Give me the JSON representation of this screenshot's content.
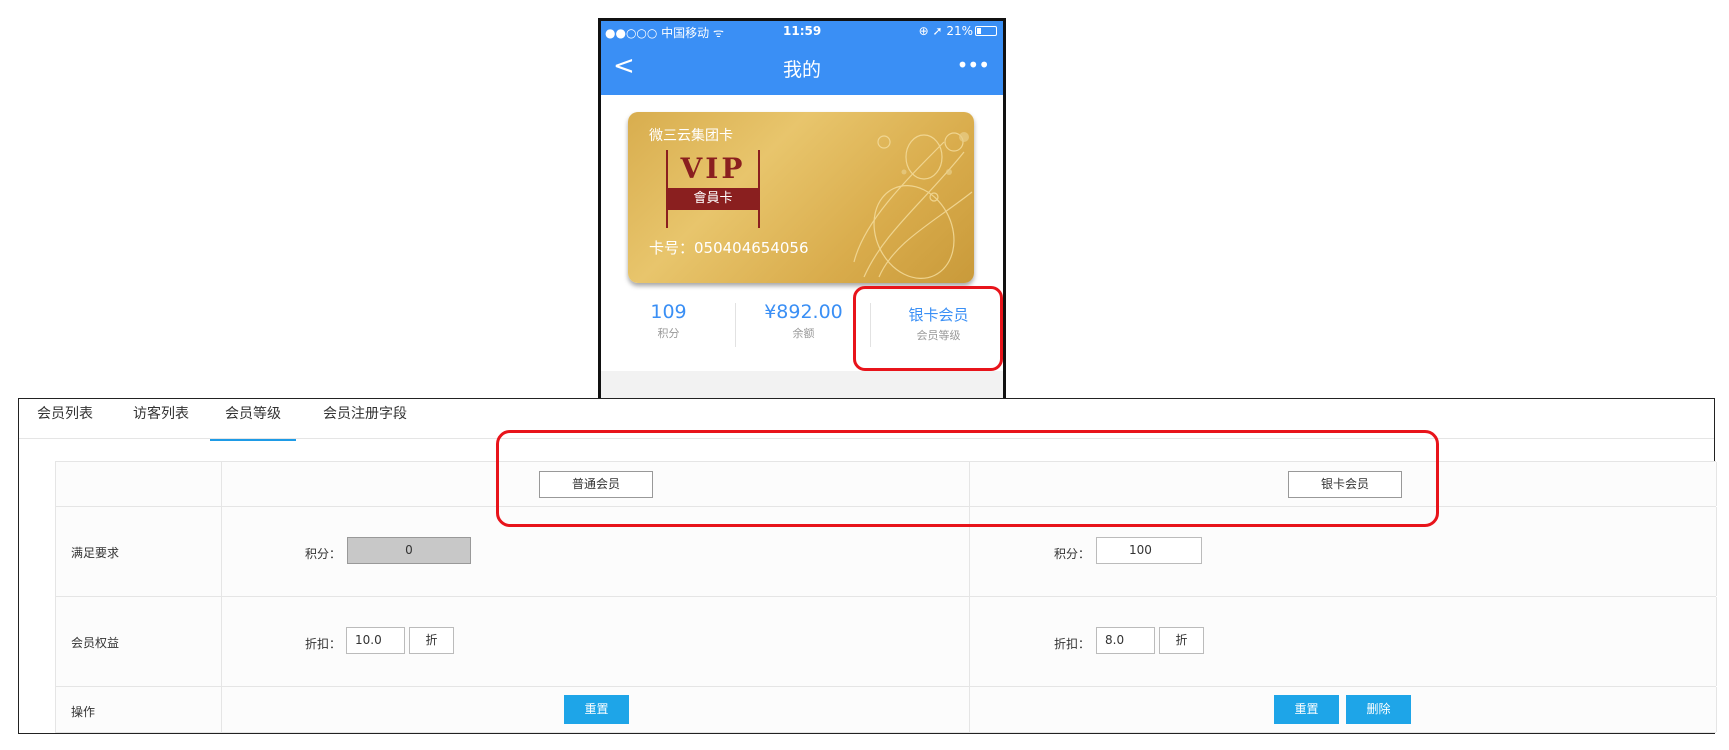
{
  "phone": {
    "status": {
      "carrier": "●●○○○ 中国移动 ᯤ",
      "time": "11:59",
      "right": "⊕ ➚ 21%"
    },
    "nav": {
      "back": "<",
      "title": "我的",
      "more": "•••"
    },
    "card": {
      "name": "微三云集团卡",
      "vip_text": "VIP",
      "vip_band": "會員卡",
      "card_number": "卡号：050404654056"
    },
    "stats": [
      {
        "value": "109",
        "label": "积分"
      },
      {
        "value": "¥892.00",
        "label": "余额"
      },
      {
        "value": "银卡会员",
        "label": "会员等级"
      }
    ]
  },
  "admin": {
    "tabs": [
      {
        "label": "会员列表",
        "active": false
      },
      {
        "label": "访客列表",
        "active": false
      },
      {
        "label": "会员等级",
        "active": true
      },
      {
        "label": "会员注册字段",
        "active": false
      }
    ],
    "levels": [
      "普通会员",
      "银卡会员"
    ],
    "rows": {
      "requirement": {
        "label": "满足要求",
        "level1": {
          "field": "积分：",
          "value": "0"
        },
        "level2": {
          "field": "积分：",
          "value": "100"
        }
      },
      "benefit": {
        "label": "会员权益",
        "level1": {
          "field": "折扣：",
          "value": "10.0",
          "unit": "折"
        },
        "level2": {
          "field": "折扣：",
          "value": "8.0",
          "unit": "折"
        }
      },
      "actions": {
        "label": "操作",
        "reset": "重置",
        "delete": "删除"
      }
    }
  },
  "colors": {
    "accent_blue": "#3a8ff5",
    "button_blue": "#1ea5e8",
    "highlight_red": "#e8141b",
    "vip_red": "#8a1f1f"
  }
}
